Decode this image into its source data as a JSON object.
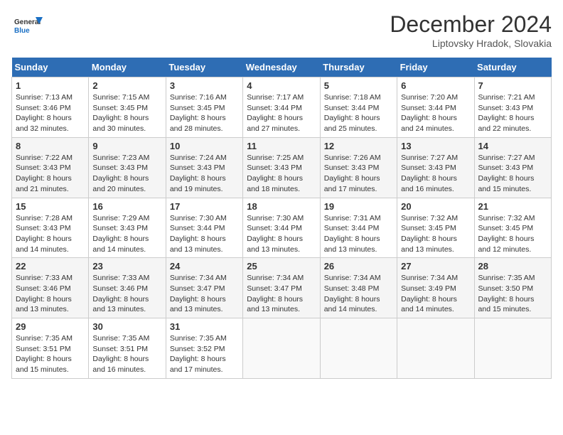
{
  "logo": {
    "line1": "General",
    "line2": "Blue"
  },
  "title": "December 2024",
  "location": "Liptovsky Hradok, Slovakia",
  "days_of_week": [
    "Sunday",
    "Monday",
    "Tuesday",
    "Wednesday",
    "Thursday",
    "Friday",
    "Saturday"
  ],
  "weeks": [
    [
      {
        "day": 1,
        "sunrise": "7:13 AM",
        "sunset": "3:46 PM",
        "daylight": "8 hours and 32 minutes."
      },
      {
        "day": 2,
        "sunrise": "7:15 AM",
        "sunset": "3:45 PM",
        "daylight": "8 hours and 30 minutes."
      },
      {
        "day": 3,
        "sunrise": "7:16 AM",
        "sunset": "3:45 PM",
        "daylight": "8 hours and 28 minutes."
      },
      {
        "day": 4,
        "sunrise": "7:17 AM",
        "sunset": "3:44 PM",
        "daylight": "8 hours and 27 minutes."
      },
      {
        "day": 5,
        "sunrise": "7:18 AM",
        "sunset": "3:44 PM",
        "daylight": "8 hours and 25 minutes."
      },
      {
        "day": 6,
        "sunrise": "7:20 AM",
        "sunset": "3:44 PM",
        "daylight": "8 hours and 24 minutes."
      },
      {
        "day": 7,
        "sunrise": "7:21 AM",
        "sunset": "3:43 PM",
        "daylight": "8 hours and 22 minutes."
      }
    ],
    [
      {
        "day": 8,
        "sunrise": "7:22 AM",
        "sunset": "3:43 PM",
        "daylight": "8 hours and 21 minutes."
      },
      {
        "day": 9,
        "sunrise": "7:23 AM",
        "sunset": "3:43 PM",
        "daylight": "8 hours and 20 minutes."
      },
      {
        "day": 10,
        "sunrise": "7:24 AM",
        "sunset": "3:43 PM",
        "daylight": "8 hours and 19 minutes."
      },
      {
        "day": 11,
        "sunrise": "7:25 AM",
        "sunset": "3:43 PM",
        "daylight": "8 hours and 18 minutes."
      },
      {
        "day": 12,
        "sunrise": "7:26 AM",
        "sunset": "3:43 PM",
        "daylight": "8 hours and 17 minutes."
      },
      {
        "day": 13,
        "sunrise": "7:27 AM",
        "sunset": "3:43 PM",
        "daylight": "8 hours and 16 minutes."
      },
      {
        "day": 14,
        "sunrise": "7:27 AM",
        "sunset": "3:43 PM",
        "daylight": "8 hours and 15 minutes."
      }
    ],
    [
      {
        "day": 15,
        "sunrise": "7:28 AM",
        "sunset": "3:43 PM",
        "daylight": "8 hours and 14 minutes."
      },
      {
        "day": 16,
        "sunrise": "7:29 AM",
        "sunset": "3:43 PM",
        "daylight": "8 hours and 14 minutes."
      },
      {
        "day": 17,
        "sunrise": "7:30 AM",
        "sunset": "3:44 PM",
        "daylight": "8 hours and 13 minutes."
      },
      {
        "day": 18,
        "sunrise": "7:30 AM",
        "sunset": "3:44 PM",
        "daylight": "8 hours and 13 minutes."
      },
      {
        "day": 19,
        "sunrise": "7:31 AM",
        "sunset": "3:44 PM",
        "daylight": "8 hours and 13 minutes."
      },
      {
        "day": 20,
        "sunrise": "7:32 AM",
        "sunset": "3:45 PM",
        "daylight": "8 hours and 13 minutes."
      },
      {
        "day": 21,
        "sunrise": "7:32 AM",
        "sunset": "3:45 PM",
        "daylight": "8 hours and 12 minutes."
      }
    ],
    [
      {
        "day": 22,
        "sunrise": "7:33 AM",
        "sunset": "3:46 PM",
        "daylight": "8 hours and 13 minutes."
      },
      {
        "day": 23,
        "sunrise": "7:33 AM",
        "sunset": "3:46 PM",
        "daylight": "8 hours and 13 minutes."
      },
      {
        "day": 24,
        "sunrise": "7:34 AM",
        "sunset": "3:47 PM",
        "daylight": "8 hours and 13 minutes."
      },
      {
        "day": 25,
        "sunrise": "7:34 AM",
        "sunset": "3:47 PM",
        "daylight": "8 hours and 13 minutes."
      },
      {
        "day": 26,
        "sunrise": "7:34 AM",
        "sunset": "3:48 PM",
        "daylight": "8 hours and 14 minutes."
      },
      {
        "day": 27,
        "sunrise": "7:34 AM",
        "sunset": "3:49 PM",
        "daylight": "8 hours and 14 minutes."
      },
      {
        "day": 28,
        "sunrise": "7:35 AM",
        "sunset": "3:50 PM",
        "daylight": "8 hours and 15 minutes."
      }
    ],
    [
      {
        "day": 29,
        "sunrise": "7:35 AM",
        "sunset": "3:51 PM",
        "daylight": "8 hours and 15 minutes."
      },
      {
        "day": 30,
        "sunrise": "7:35 AM",
        "sunset": "3:51 PM",
        "daylight": "8 hours and 16 minutes."
      },
      {
        "day": 31,
        "sunrise": "7:35 AM",
        "sunset": "3:52 PM",
        "daylight": "8 hours and 17 minutes."
      },
      null,
      null,
      null,
      null
    ]
  ]
}
